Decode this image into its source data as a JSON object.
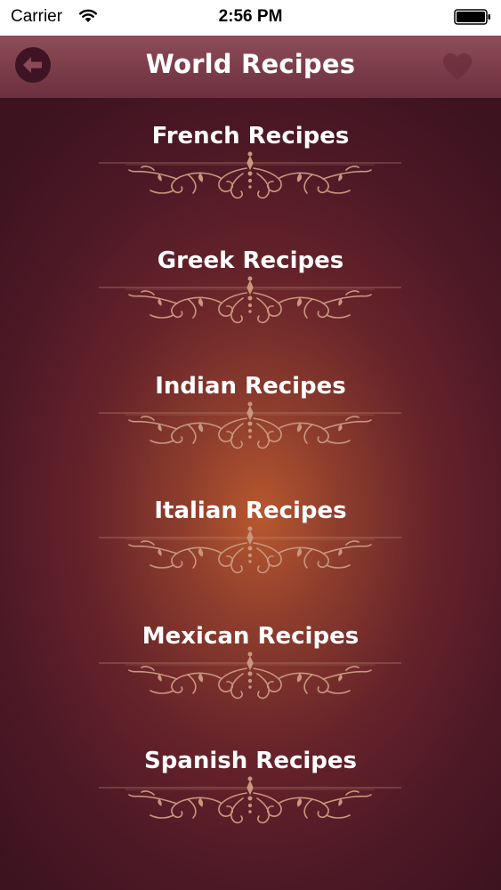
{
  "status_bar": {
    "carrier": "Carrier",
    "time": "2:56 PM",
    "icons": [
      "wifi-icon",
      "battery-icon"
    ]
  },
  "nav": {
    "title": "World Recipes",
    "back_icon": "arrow-left-icon",
    "favorites_icon": "heart-icon"
  },
  "recipes": [
    {
      "label": "French Recipes"
    },
    {
      "label": "Greek Recipes"
    },
    {
      "label": "Indian Recipes"
    },
    {
      "label": "Italian Recipes"
    },
    {
      "label": "Mexican Recipes"
    },
    {
      "label": "Spanish Recipes"
    }
  ],
  "colors": {
    "background_dark": "#4d1826",
    "background_glow": "#b8582f",
    "nav_bar": "#7b3c49",
    "ornament": "#c9977e",
    "text": "#ffffff"
  }
}
